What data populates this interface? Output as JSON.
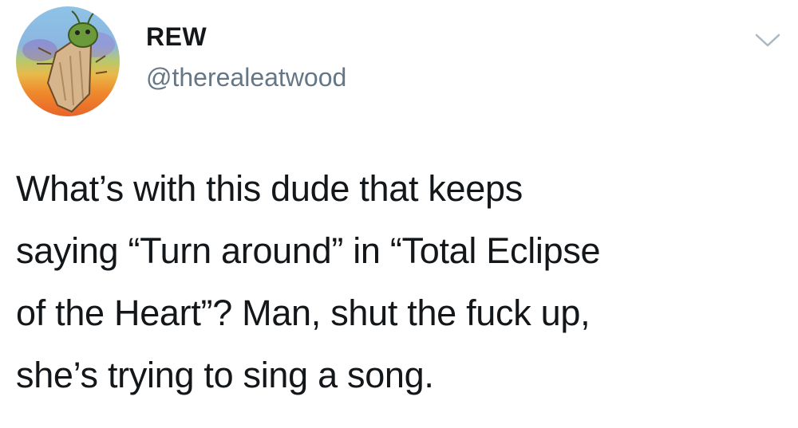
{
  "user": {
    "display_name": "REW",
    "handle": "@therealeatwood",
    "avatar_icon": "cartoon-cicada-avatar-icon"
  },
  "menu": {
    "icon": "chevron-down-icon"
  },
  "tweet": {
    "lines": [
      "What’s with this dude that keeps",
      "saying “Turn around” in “Total Eclipse",
      "of the Heart”? Man, shut the fuck up,",
      "she’s trying to sing a song."
    ]
  },
  "colors": {
    "text": "#14171a",
    "handle": "#657786",
    "chevron": "#aab8c2"
  }
}
